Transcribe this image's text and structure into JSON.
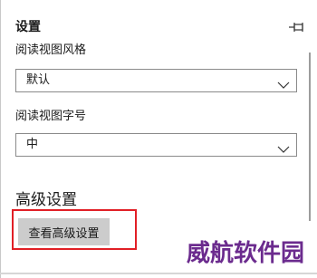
{
  "header": {
    "title": "设置",
    "pin_icon": "pin-icon"
  },
  "reading_view_style": {
    "label": "阅读视图风格",
    "selected": "默认"
  },
  "reading_view_font_size": {
    "label": "阅读视图字号",
    "selected": "中"
  },
  "advanced": {
    "heading": "高级设置",
    "button_label": "查看高级设置"
  },
  "colors": {
    "highlight": "#e11f26",
    "button_bg": "#cccccc",
    "watermark": "#6b2b8e"
  },
  "watermark": {
    "text": "威航软件园"
  }
}
